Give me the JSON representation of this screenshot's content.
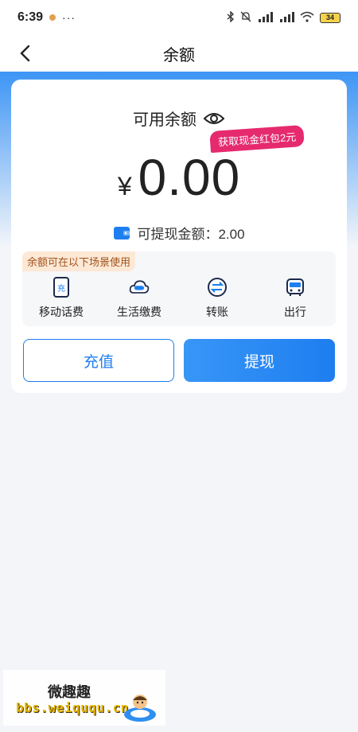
{
  "status_bar": {
    "time": "6:39",
    "more": "···",
    "battery": "34"
  },
  "nav": {
    "title": "余额"
  },
  "balance": {
    "label": "可用余额",
    "promo": "获取现金红包2元",
    "currency": "¥",
    "amount": "0.00",
    "withdrawable": "可提现金额：2.00"
  },
  "scenes": {
    "tag": "余额可在以下场景使用",
    "items": [
      {
        "label": "移动话费",
        "icon": "phone-bill-icon"
      },
      {
        "label": "生活缴费",
        "icon": "utility-cloud-icon"
      },
      {
        "label": "转账",
        "icon": "transfer-icon"
      },
      {
        "label": "出行",
        "icon": "bus-icon"
      }
    ]
  },
  "actions": {
    "recharge": "充值",
    "withdraw": "提现"
  },
  "watermark": {
    "title": "微趣趣",
    "url": "bbs.weiququ.cn"
  },
  "colors": {
    "accent": "#1e7ef0",
    "promo": "#e62a6e",
    "tag_bg": "#fde8d6"
  }
}
